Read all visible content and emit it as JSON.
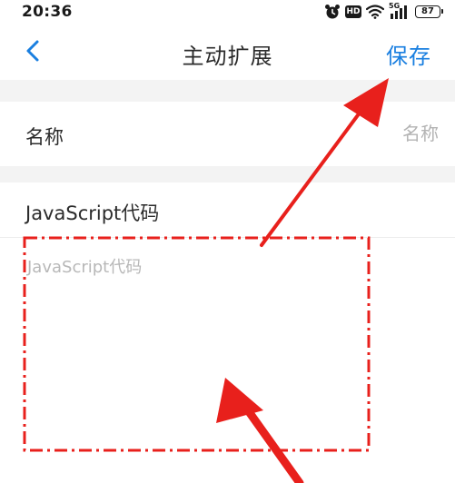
{
  "status_bar": {
    "time": "20:36",
    "hd": "HD",
    "network": "5G",
    "battery": "87"
  },
  "nav": {
    "title": "主动扩展",
    "save_label": "保存"
  },
  "form": {
    "name_label": "名称",
    "name_placeholder": "名称",
    "js_label": "JavaScript代码",
    "js_placeholder": "JavaScript代码"
  },
  "colors": {
    "accent": "#1a7fe0",
    "annotation": "#e8201c",
    "section_gap": "#f3f3f3"
  },
  "icons": {
    "back": "chevron-left-icon",
    "alarm": "alarm-clock-icon",
    "wifi": "wifi-icon",
    "signal": "cellular-signal-icon",
    "battery": "battery-icon"
  }
}
